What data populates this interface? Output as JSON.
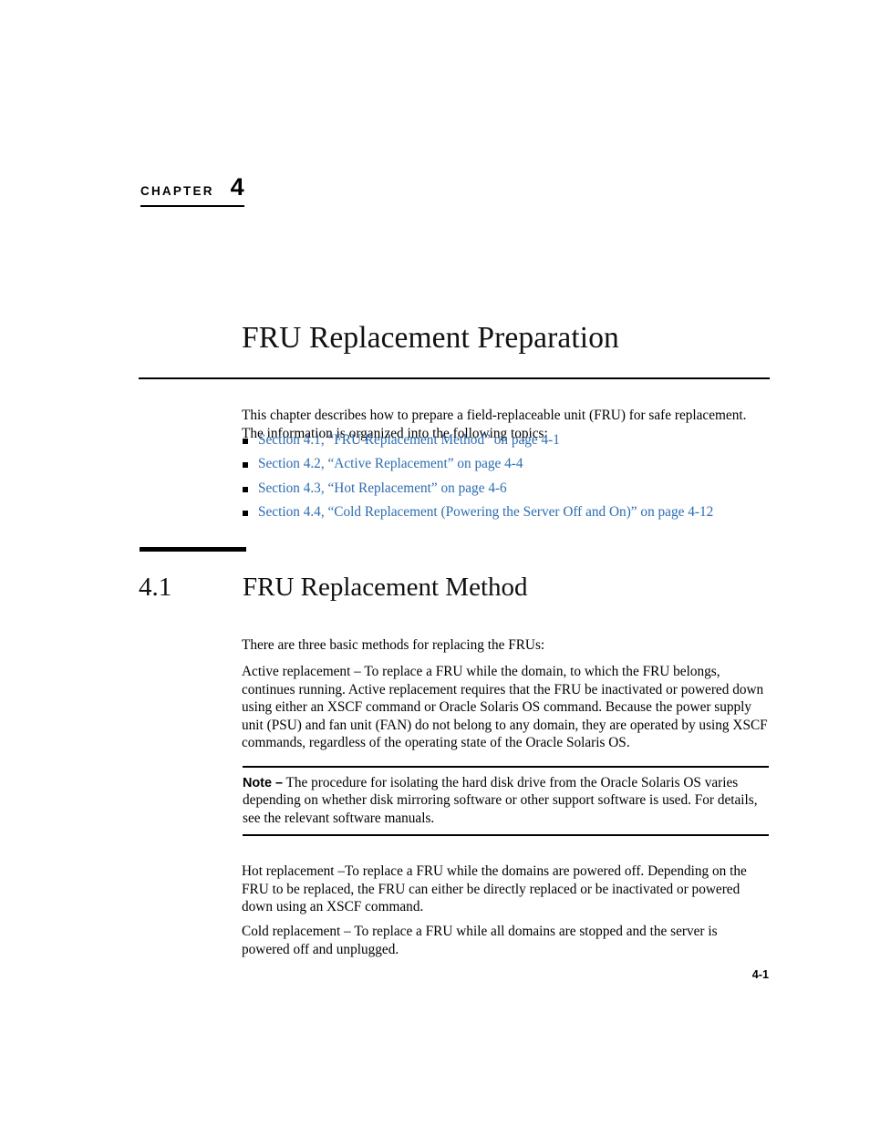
{
  "chapter": {
    "label": "CHAPTER",
    "number": "4"
  },
  "title": "FRU Replacement Preparation",
  "intro": "This chapter describes how to prepare a field-replaceable unit (FRU) for safe replacement. The information is organized into the following topics:",
  "topics": [
    {
      "text": "Section 4.1, “FRU Replacement Method” on page 4-1"
    },
    {
      "text": "Section 4.2, “Active Replacement” on page 4-4"
    },
    {
      "text": "Section 4.3, “Hot Replacement” on page 4-6"
    },
    {
      "text": "Section 4.4, “Cold Replacement (Powering the Server Off and On)” on page 4-12"
    }
  ],
  "section": {
    "number": "4.1",
    "title": "FRU Replacement Method"
  },
  "paragraphs": {
    "methods_intro": "There are three basic methods for replacing the FRUs:",
    "active": "Active replacement – To replace a FRU while the domain, to which the FRU belongs, continues running. Active replacement requires that the FRU be inactivated or powered down using either an XSCF command or Oracle Solaris OS command. Because the power supply unit (PSU) and fan unit (FAN) do not belong to any domain, they are operated by using XSCF commands, regardless of the operating state of the Oracle Solaris OS.",
    "hot": "Hot replacement –To replace a FRU while the domains are powered off. Depending on the FRU to be replaced, the FRU can either be directly replaced or be inactivated or powered down using an XSCF command.",
    "cold": "Cold replacement – To replace a FRU while all domains are stopped and the server is powered off and unplugged."
  },
  "note": {
    "label": "Note –",
    "text": " The procedure for isolating the hard disk drive from the Oracle Solaris OS varies depending on whether disk mirroring software or other support software is used. For details, see the relevant software manuals."
  },
  "footer": {
    "page_number": "4-1"
  },
  "colors": {
    "link": "#2d6cb0",
    "text": "#000000",
    "background": "#ffffff"
  }
}
